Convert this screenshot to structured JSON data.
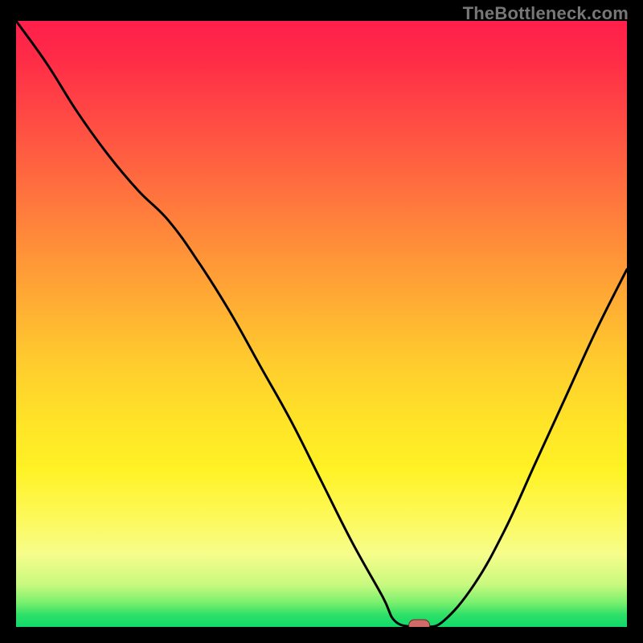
{
  "watermark": "TheBottleneck.com",
  "colors": {
    "gradient_top": "#ff1f4b",
    "gradient_bottom": "#10d96a",
    "curve": "#000000",
    "marker": "#d36a6a",
    "frame": "#000000"
  },
  "chart_data": {
    "type": "line",
    "title": "",
    "xlabel": "",
    "ylabel": "",
    "xlim": [
      0,
      100
    ],
    "ylim": [
      0,
      100
    ],
    "x": [
      0,
      5,
      10,
      15,
      20,
      25,
      30,
      35,
      40,
      45,
      50,
      55,
      60,
      62,
      65,
      67,
      70,
      75,
      80,
      85,
      90,
      95,
      100
    ],
    "values": [
      100,
      93,
      85,
      78,
      72,
      67,
      60,
      52,
      43,
      34,
      24,
      14,
      5,
      1,
      0,
      0,
      1,
      7,
      16,
      27,
      38,
      49,
      59
    ],
    "annotations": [
      {
        "type": "marker",
        "x": 66,
        "y": 0,
        "label": "minimum"
      }
    ]
  }
}
